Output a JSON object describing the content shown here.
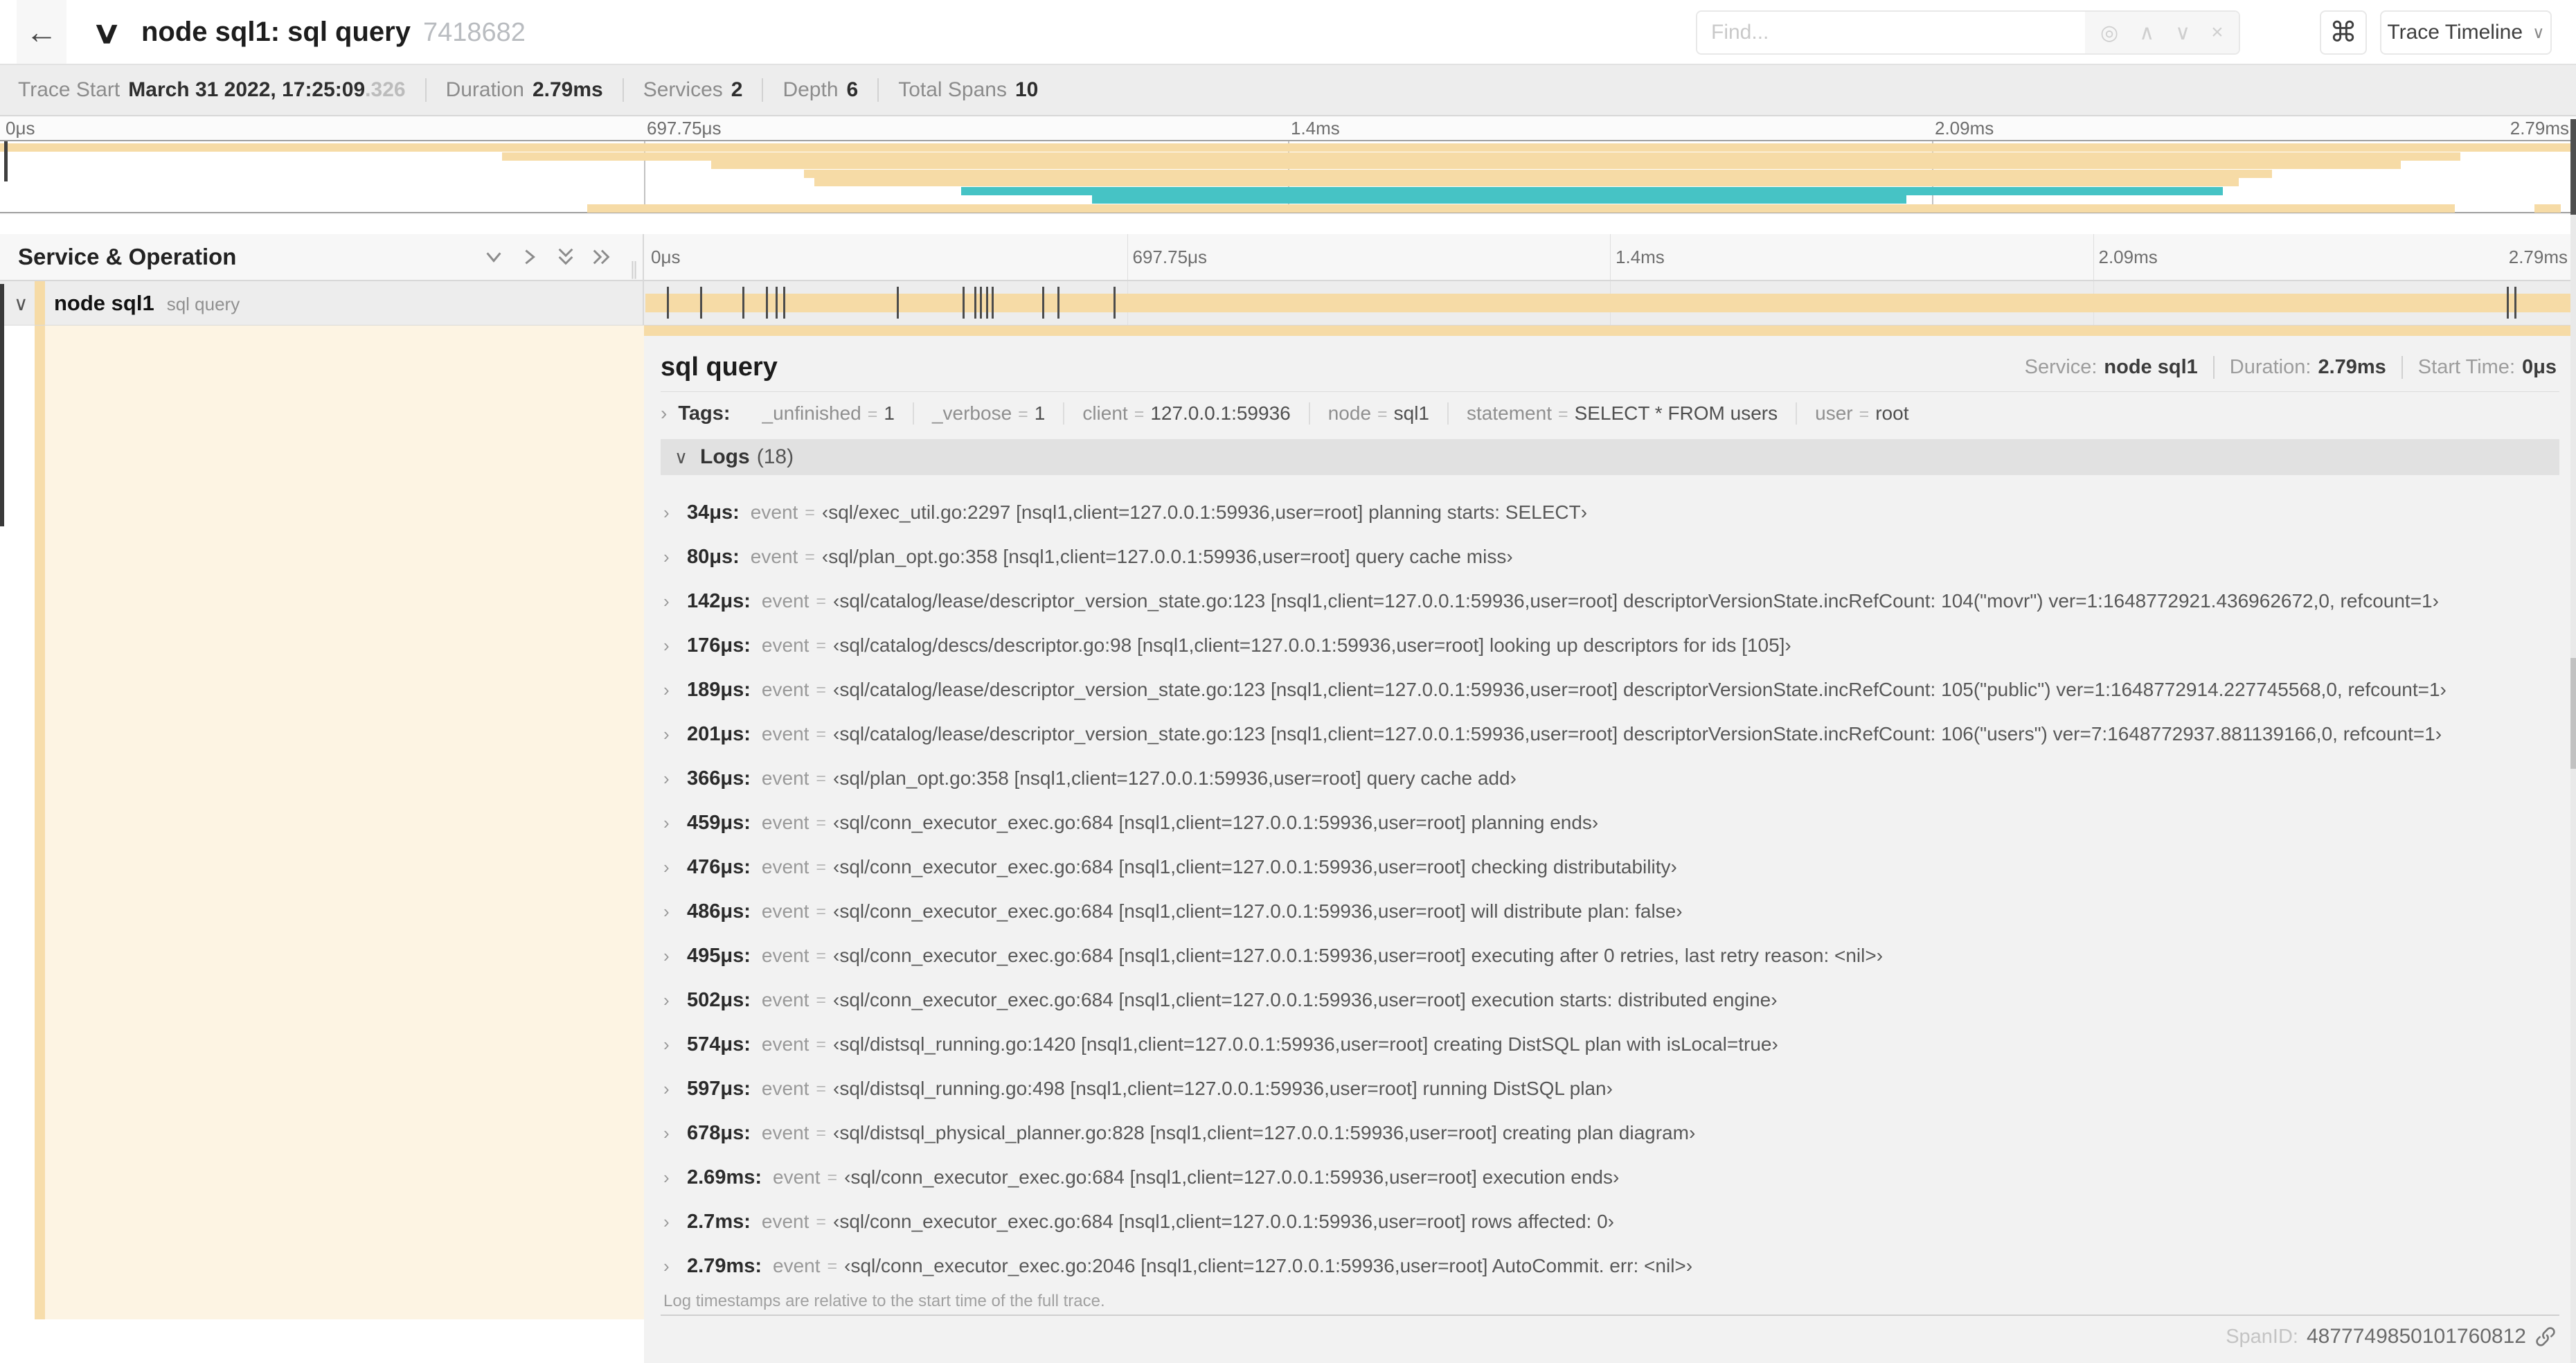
{
  "colors": {
    "tan": "#f6dba6",
    "teal": "#46c3c5",
    "cream": "#fdf4e3",
    "indent_stripe": "#f7ddab"
  },
  "header": {
    "back_icon": "←",
    "collapse_chevron": "∨",
    "title": "node sql1: sql query",
    "trace_id": "7418682",
    "find_placeholder": "Find...",
    "locate_icon": "◎",
    "prev_icon": "∧",
    "next_icon": "∨",
    "clear_icon": "×",
    "shortcut_icon": "⌘",
    "view_selector": "Trace Timeline",
    "view_chevron": "∨"
  },
  "summary": {
    "items": [
      {
        "label": "Trace Start",
        "value": "March 31 2022, 17:25:09",
        "frac": ".326"
      },
      {
        "label": "Duration",
        "value": "2.79ms",
        "frac": ""
      },
      {
        "label": "Services",
        "value": "2",
        "frac": ""
      },
      {
        "label": "Depth",
        "value": "6",
        "frac": ""
      },
      {
        "label": "Total Spans",
        "value": "10",
        "frac": ""
      }
    ]
  },
  "axis": [
    "0μs",
    "697.75μs",
    "1.4ms",
    "2.09ms",
    "2.79ms"
  ],
  "minimap": {
    "spans": [
      {
        "row": 0,
        "start_pct": 0,
        "end_pct": 99.8,
        "color": "tan"
      },
      {
        "row": 1,
        "start_pct": 19.5,
        "end_pct": 95.5,
        "color": "tan"
      },
      {
        "row": 2,
        "start_pct": 27.6,
        "end_pct": 93.2,
        "color": "tan"
      },
      {
        "row": 3,
        "start_pct": 31.2,
        "end_pct": 88.2,
        "color": "tan"
      },
      {
        "row": 4,
        "start_pct": 31.6,
        "end_pct": 86.9,
        "color": "tan"
      },
      {
        "row": 5,
        "start_pct": 37.3,
        "end_pct": 86.3,
        "color": "teal"
      },
      {
        "row": 6,
        "start_pct": 42.4,
        "end_pct": 74.0,
        "color": "teal"
      },
      {
        "row": 7,
        "start_pct": 22.8,
        "end_pct": 95.3,
        "color": "tan"
      },
      {
        "row": 7,
        "start_pct": 98.4,
        "end_pct": 99.4,
        "color": "tan"
      }
    ]
  },
  "timeline": {
    "left_header": "Service & Operation",
    "resizer_icon": "∥",
    "row": {
      "chevron": "∨",
      "service": "node sql1",
      "operation": "sql query"
    },
    "log_marker_pct": [
      1.2,
      2.9,
      5.1,
      6.3,
      6.8,
      7.2,
      13.1,
      16.5,
      17.1,
      17.4,
      17.7,
      18.0,
      20.6,
      21.4,
      24.3,
      96.4,
      96.8,
      99.8
    ]
  },
  "detail": {
    "title": "sql query",
    "meta": [
      {
        "label": "Service:",
        "value": "node sql1"
      },
      {
        "label": "Duration:",
        "value": "2.79ms"
      },
      {
        "label": "Start Time:",
        "value": "0μs"
      }
    ],
    "tags_chevron": "›",
    "tags_label": "Tags:",
    "tags": [
      {
        "key": "_unfinished",
        "value": "1"
      },
      {
        "key": "_verbose",
        "value": "1"
      },
      {
        "key": "client",
        "value": "127.0.0.1:59936"
      },
      {
        "key": "node",
        "value": "sql1"
      },
      {
        "key": "statement",
        "value": "SELECT * FROM users"
      },
      {
        "key": "user",
        "value": "root"
      }
    ],
    "logs_chevron": "∨",
    "logs_label": "Logs",
    "logs_count": "(18)",
    "log_key": "event",
    "log_eq": "=",
    "logs": [
      {
        "time": "34μs:",
        "value": "‹sql/exec_util.go:2297 [nsql1,client=127.0.0.1:59936,user=root] planning starts: SELECT›"
      },
      {
        "time": "80μs:",
        "value": "‹sql/plan_opt.go:358 [nsql1,client=127.0.0.1:59936,user=root] query cache miss›"
      },
      {
        "time": "142μs:",
        "value": "‹sql/catalog/lease/descriptor_version_state.go:123 [nsql1,client=127.0.0.1:59936,user=root] descriptorVersionState.incRefCount: 104(\"movr\") ver=1:1648772921.436962672,0, refcount=1›"
      },
      {
        "time": "176μs:",
        "value": "‹sql/catalog/descs/descriptor.go:98 [nsql1,client=127.0.0.1:59936,user=root] looking up descriptors for ids [105]›"
      },
      {
        "time": "189μs:",
        "value": "‹sql/catalog/lease/descriptor_version_state.go:123 [nsql1,client=127.0.0.1:59936,user=root] descriptorVersionState.incRefCount: 105(\"public\") ver=1:1648772914.227745568,0, refcount=1›"
      },
      {
        "time": "201μs:",
        "value": "‹sql/catalog/lease/descriptor_version_state.go:123 [nsql1,client=127.0.0.1:59936,user=root] descriptorVersionState.incRefCount: 106(\"users\") ver=7:1648772937.881139166,0, refcount=1›"
      },
      {
        "time": "366μs:",
        "value": "‹sql/plan_opt.go:358 [nsql1,client=127.0.0.1:59936,user=root] query cache add›"
      },
      {
        "time": "459μs:",
        "value": "‹sql/conn_executor_exec.go:684 [nsql1,client=127.0.0.1:59936,user=root] planning ends›"
      },
      {
        "time": "476μs:",
        "value": "‹sql/conn_executor_exec.go:684 [nsql1,client=127.0.0.1:59936,user=root] checking distributability›"
      },
      {
        "time": "486μs:",
        "value": "‹sql/conn_executor_exec.go:684 [nsql1,client=127.0.0.1:59936,user=root] will distribute plan: false›"
      },
      {
        "time": "495μs:",
        "value": "‹sql/conn_executor_exec.go:684 [nsql1,client=127.0.0.1:59936,user=root] executing after 0 retries, last retry reason: <nil>›"
      },
      {
        "time": "502μs:",
        "value": "‹sql/conn_executor_exec.go:684 [nsql1,client=127.0.0.1:59936,user=root] execution starts: distributed engine›"
      },
      {
        "time": "574μs:",
        "value": "‹sql/distsql_running.go:1420 [nsql1,client=127.0.0.1:59936,user=root] creating DistSQL plan with isLocal=true›"
      },
      {
        "time": "597μs:",
        "value": "‹sql/distsql_running.go:498 [nsql1,client=127.0.0.1:59936,user=root] running DistSQL plan›"
      },
      {
        "time": "678μs:",
        "value": "‹sql/distsql_physical_planner.go:828 [nsql1,client=127.0.0.1:59936,user=root] creating plan diagram›"
      },
      {
        "time": "2.69ms:",
        "value": "‹sql/conn_executor_exec.go:684 [nsql1,client=127.0.0.1:59936,user=root] execution ends›"
      },
      {
        "time": "2.7ms:",
        "value": "‹sql/conn_executor_exec.go:684 [nsql1,client=127.0.0.1:59936,user=root] rows affected: 0›"
      },
      {
        "time": "2.79ms:",
        "value": "‹sql/conn_executor_exec.go:2046 [nsql1,client=127.0.0.1:59936,user=root] AutoCommit. err: <nil>›"
      }
    ],
    "footer_note": "Log timestamps are relative to the start time of the full trace.",
    "spanid_label": "SpanID:",
    "spanid_value": "4877749850101760812"
  }
}
